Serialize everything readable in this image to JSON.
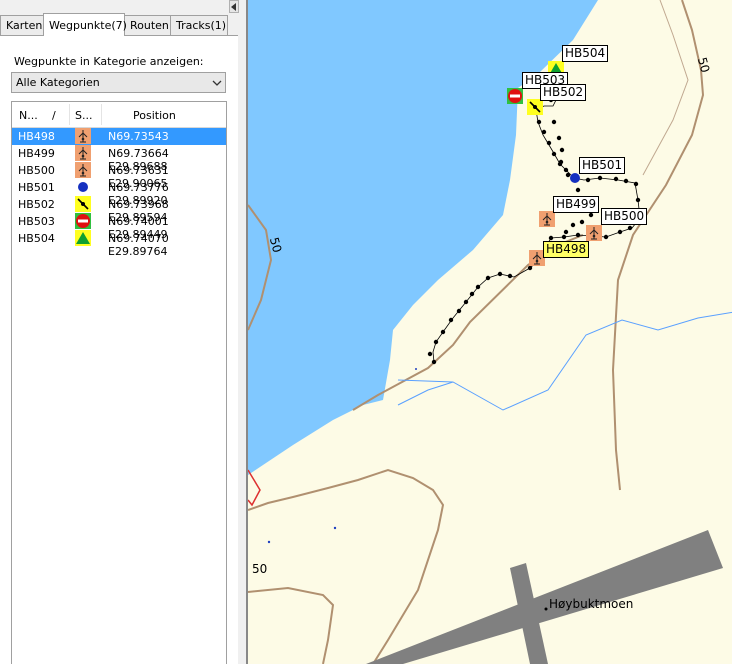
{
  "tabs": [
    {
      "label": "Karten",
      "active": false
    },
    {
      "label": "Wegpunkte(7)",
      "active": true
    },
    {
      "label": "Routen",
      "active": false
    },
    {
      "label": "Tracks(1)",
      "active": false
    }
  ],
  "category": {
    "label": "Wegpunkte in Kategorie anzeigen:",
    "selected": "Alle Kategorien"
  },
  "columns": {
    "name": "N...",
    "sort": "/",
    "symbol": "S...",
    "position": "Position"
  },
  "waypoints": [
    {
      "name": "HB498",
      "symbol": "tower-icon",
      "position": "N69.73543 E29.89614",
      "selected": true
    },
    {
      "name": "HB499",
      "symbol": "tower-icon",
      "position": "N69.73664 E29.89688",
      "selected": false
    },
    {
      "name": "HB500",
      "symbol": "tower-icon",
      "position": "N69.73631 E29.90065",
      "selected": false
    },
    {
      "name": "HB501",
      "symbol": "dot-icon",
      "position": "N69.73776 E29.89920",
      "selected": false
    },
    {
      "name": "HB502",
      "symbol": "no-entry-yellow-icon",
      "position": "N69.73968 E29.89594",
      "selected": false
    },
    {
      "name": "HB503",
      "symbol": "no-entry-red-icon",
      "position": "N69.74001 E29.89449",
      "selected": false
    },
    {
      "name": "HB504",
      "symbol": "summit-icon",
      "position": "N69.74070 E29.89764",
      "selected": false
    }
  ],
  "map": {
    "labels": [
      "HB504",
      "HB503",
      "HB502",
      "HB501",
      "HB499",
      "HB500",
      "HB498"
    ],
    "contours": [
      "50",
      "50",
      "50"
    ],
    "place": "Høybuktmoen"
  },
  "colors": {
    "water": "#80c8ff",
    "land": "#fdfbe6",
    "contour": "#b09070",
    "selection": "#3399ff",
    "tower": "#f0a070",
    "runway": "#808080"
  }
}
